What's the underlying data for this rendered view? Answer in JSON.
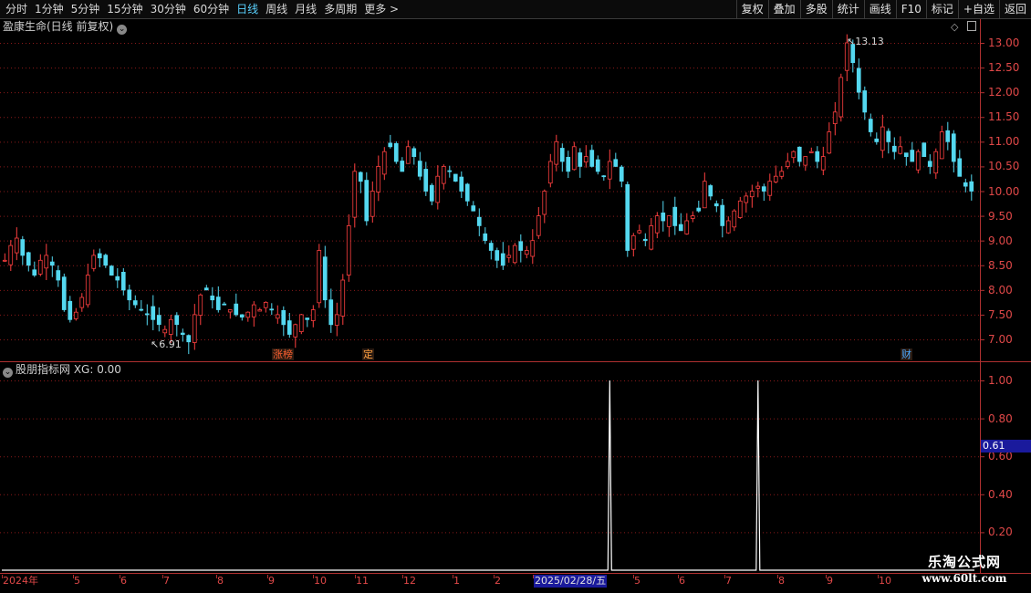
{
  "toolbar": {
    "periods": [
      "分时",
      "1分钟",
      "5分钟",
      "15分钟",
      "30分钟",
      "60分钟",
      "日线",
      "周线",
      "月线",
      "多周期",
      "更多 >"
    ],
    "active_period": "日线",
    "actions": [
      "复权",
      "叠加",
      "多股",
      "统计",
      "画线",
      "F10",
      "标记",
      "+自选",
      "返回"
    ]
  },
  "chart_title": "盈康生命(日线 前复权)",
  "indicator_title": "股朋指标网 XG: 0.00",
  "price_axis": [
    "13.00",
    "12.50",
    "12.00",
    "11.50",
    "11.00",
    "10.50",
    "10.00",
    "9.50",
    "9.00",
    "8.50",
    "8.00",
    "7.50",
    "7.00"
  ],
  "indicator_axis": [
    "1.00",
    "0.80",
    "0.60",
    "0.40",
    "0.20"
  ],
  "indicator_marker": "0.61",
  "annotations": {
    "high": "13.13",
    "low": "6.91"
  },
  "event_tags": [
    {
      "label": "涨榜",
      "color": "#ff6030"
    },
    {
      "label": "定",
      "color": "#ffa040"
    },
    {
      "label": "财",
      "color": "#4aa8ff"
    }
  ],
  "x_axis": [
    "2024年",
    "5",
    "6",
    "7",
    "8",
    "9",
    "10",
    "11",
    "12",
    "1",
    "2",
    "2025/02/28/五",
    "5",
    "6",
    "7",
    "8",
    "9",
    "10"
  ],
  "watermark": {
    "line1": "乐淘公式网",
    "line2": "www.60lt.com"
  },
  "colors": {
    "up": "#ff4040",
    "down": "#54d8f0",
    "grid": "#8a1a1a",
    "axis": "#b03030"
  },
  "chart_data": {
    "type": "candlestick",
    "title": "盈康生命(日线 前复权)",
    "y_range": [
      6.7,
      13.2
    ],
    "price_high": 13.13,
    "price_low": 6.91,
    "close_series": [
      8.6,
      8.9,
      9.05,
      8.7,
      8.5,
      8.3,
      8.6,
      8.7,
      8.5,
      8.2,
      7.6,
      7.4,
      7.55,
      7.85,
      8.3,
      8.7,
      8.65,
      8.5,
      8.3,
      8.2,
      8.0,
      7.8,
      7.7,
      7.6,
      7.5,
      7.4,
      7.3,
      7.2,
      7.4,
      7.3,
      7.1,
      6.95,
      7.5,
      7.9,
      8.0,
      7.8,
      7.6,
      7.7,
      7.6,
      7.5,
      7.45,
      7.55,
      7.7,
      7.6,
      7.75,
      7.6,
      7.5,
      7.3,
      7.1,
      7.3,
      7.5,
      7.4,
      7.6,
      8.8,
      7.8,
      7.3,
      7.5,
      8.2,
      9.3,
      10.4,
      10.2,
      9.4,
      10.0,
      10.5,
      10.8,
      10.9,
      10.6,
      10.4,
      10.9,
      10.7,
      10.3,
      10.0,
      9.8,
      10.3,
      10.5,
      10.4,
      10.2,
      10.0,
      9.8,
      9.6,
      9.3,
      9.0,
      8.8,
      8.6,
      8.5,
      8.7,
      8.9,
      8.8,
      8.8,
      9.0,
      9.5,
      10.0,
      10.6,
      11.0,
      10.6,
      10.4,
      10.9,
      10.5,
      10.7,
      10.5,
      10.4,
      10.3,
      10.6,
      10.5,
      10.2,
      8.8,
      9.1,
      9.2,
      9.0,
      9.3,
      9.5,
      9.4,
      9.5,
      9.3,
      9.2,
      9.4,
      9.5,
      9.6,
      10.2,
      9.9,
      9.7,
      9.3,
      9.4,
      9.6,
      9.8,
      9.9,
      10.0,
      10.1,
      10.0,
      10.2,
      10.3,
      10.4,
      10.6,
      10.8,
      10.6,
      10.7,
      10.8,
      10.6,
      10.7,
      11.2,
      11.6,
      12.3,
      13.0,
      12.6,
      12.0,
      11.6,
      11.2,
      11.0,
      11.3,
      11.0,
      10.8,
      10.9,
      10.7,
      10.6,
      10.8,
      10.7,
      10.5,
      10.8,
      11.2,
      11.0,
      10.6,
      10.3,
      10.1,
      10.0
    ],
    "indicator": {
      "name": "XG",
      "value": 0.0,
      "signal_indices": [
        102,
        127
      ],
      "y_range": [
        0,
        1.0
      ]
    }
  }
}
